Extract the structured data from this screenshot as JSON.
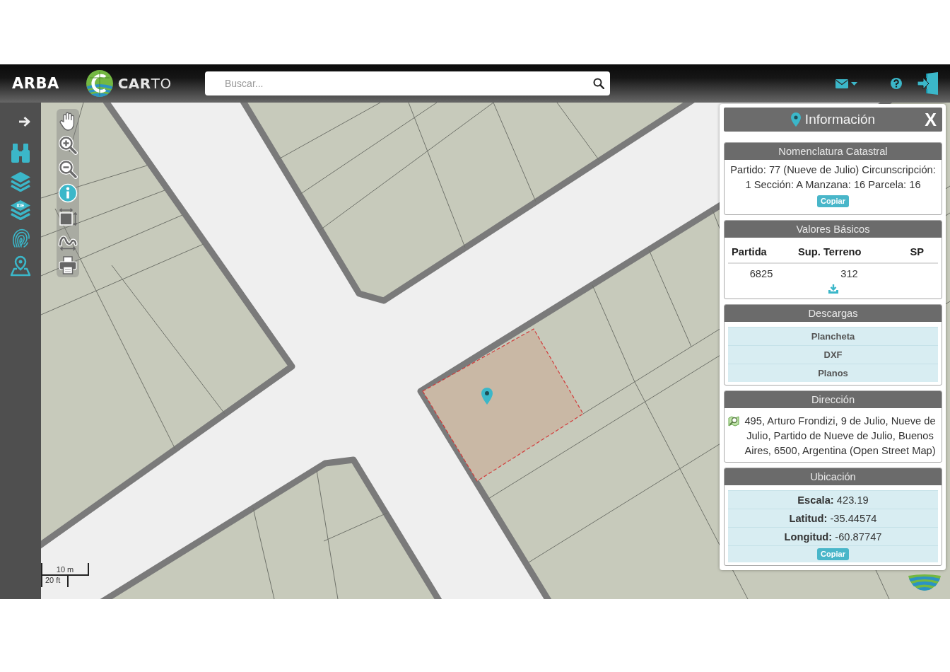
{
  "header": {
    "brand": "ARBA",
    "logo_text": "**CAR**TO",
    "search": {
      "placeholder": "Buscar..."
    }
  },
  "sidebar": {
    "items": [
      {
        "kind": "expand"
      },
      {
        "kind": "search"
      },
      {
        "kind": "layers"
      },
      {
        "kind": "ide_layers",
        "label": "IDE"
      },
      {
        "kind": "fingerprint"
      },
      {
        "kind": "location"
      }
    ]
  },
  "map": {
    "tools": [
      {
        "kind": "pan",
        "selected": false
      },
      {
        "kind": "zoom_in",
        "selected": false
      },
      {
        "kind": "zoom_out",
        "selected": false
      },
      {
        "kind": "info",
        "selected": true
      },
      {
        "kind": "extent",
        "selected": false
      },
      {
        "kind": "measure",
        "selected": false
      },
      {
        "kind": "print",
        "selected": false
      }
    ],
    "scale_bar": {
      "metric": "10 m",
      "imperial": "20 ft"
    }
  },
  "info_panel": {
    "title": "Información",
    "close": "X",
    "sections": [
      {
        "kind": "text",
        "title": "Nomenclatura Catastral",
        "text": "Partido: 77 (Nueve de Julio) Circunscripción: 1 Sección: A Manzana: 16 Parcela: 16",
        "button": "Copiar"
      },
      {
        "kind": "table",
        "title": "Valores Básicos",
        "columns": [
          "Partida",
          "Sup. Terreno",
          "SP"
        ],
        "rows": [
          [
            "6825",
            "312"
          ]
        ]
      },
      {
        "kind": "links",
        "title": "Descargas",
        "items": [
          "Plancheta",
          "DXF",
          "Planos"
        ]
      },
      {
        "kind": "address",
        "title": "Dirección",
        "text": "495, Arturo Frondizi, 9 de Julio, Nueve de Julio, Partido de Nueve de Julio, Buenos Aires, 6500, Argentina (Open Street Map)"
      },
      {
        "kind": "fields",
        "title": "Ubicación",
        "rows": [
          "**Escala:** 423.19",
          "**Latitud:** -35.44574",
          "**Longitud:** -60.87747"
        ],
        "button": "Copiar"
      }
    ]
  }
}
